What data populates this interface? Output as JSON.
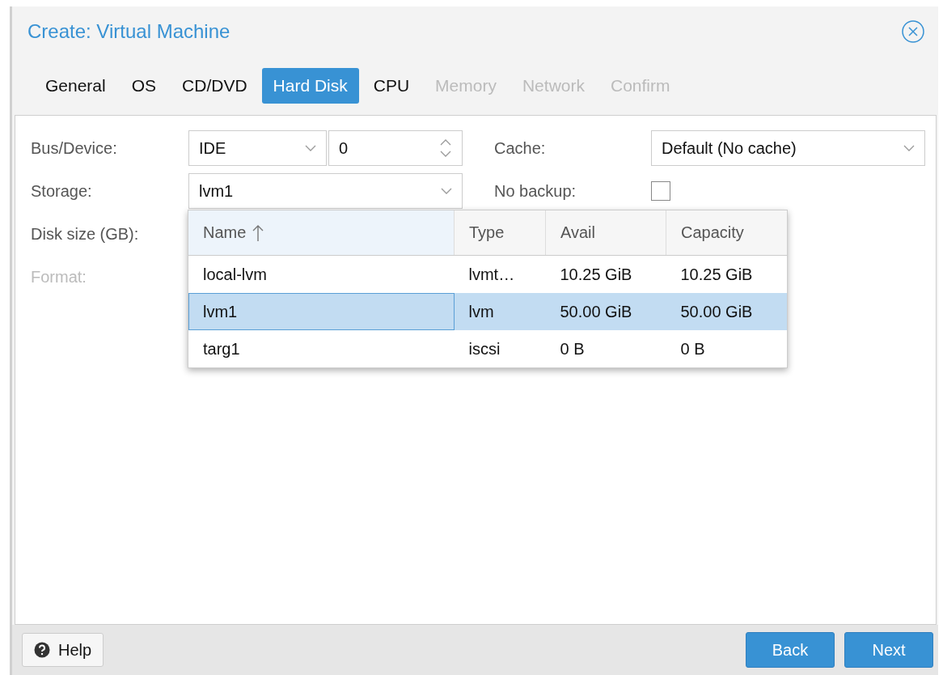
{
  "window": {
    "title": "Create: Virtual Machine"
  },
  "tabs": [
    {
      "label": "General",
      "selected": false,
      "disabled": false
    },
    {
      "label": "OS",
      "selected": false,
      "disabled": false
    },
    {
      "label": "CD/DVD",
      "selected": false,
      "disabled": false
    },
    {
      "label": "Hard Disk",
      "selected": true,
      "disabled": false
    },
    {
      "label": "CPU",
      "selected": false,
      "disabled": false
    },
    {
      "label": "Memory",
      "selected": false,
      "disabled": true
    },
    {
      "label": "Network",
      "selected": false,
      "disabled": true
    },
    {
      "label": "Confirm",
      "selected": false,
      "disabled": true
    }
  ],
  "form": {
    "bus_device": {
      "label": "Bus/Device:",
      "bus": "IDE",
      "device": "0"
    },
    "storage": {
      "label": "Storage:",
      "value": "lvm1",
      "expanded": true
    },
    "disk_size": {
      "label": "Disk size (GB):"
    },
    "format": {
      "label": "Format:",
      "disabled": true
    },
    "cache": {
      "label": "Cache:",
      "value": "Default (No cache)"
    },
    "no_backup": {
      "label": "No backup:",
      "checked": false
    }
  },
  "storage_list": {
    "columns": [
      {
        "label": "Name",
        "sorted": true
      },
      {
        "label": "Type",
        "sorted": false
      },
      {
        "label": "Avail",
        "sorted": false
      },
      {
        "label": "Capacity",
        "sorted": false
      }
    ],
    "rows": [
      {
        "cells": [
          "local-lvm",
          "lvmt…",
          "10.25 GiB",
          "10.25 GiB"
        ],
        "selected": false
      },
      {
        "cells": [
          "lvm1",
          "lvm",
          "50.00 GiB",
          "50.00 GiB"
        ],
        "selected": true
      },
      {
        "cells": [
          "targ1",
          "iscsi",
          "0 B",
          "0 B"
        ],
        "selected": false
      }
    ]
  },
  "footer": {
    "help": "Help",
    "back": "Back",
    "next": "Next"
  }
}
